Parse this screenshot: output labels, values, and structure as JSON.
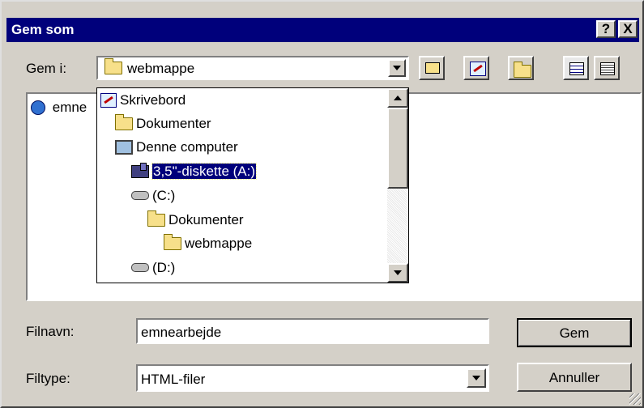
{
  "window": {
    "title": "Gem som",
    "help_label": "?",
    "close_label": "X"
  },
  "location": {
    "label": "Gem i:",
    "current": "webmappe"
  },
  "file_list": {
    "items": [
      {
        "name": "emne",
        "icon": "ie-icon"
      }
    ]
  },
  "dropdown_tree": {
    "items": [
      {
        "label": "Skrivebord",
        "icon": "desktop-icon",
        "indent": 0,
        "selected": false
      },
      {
        "label": "Dokumenter",
        "icon": "folder-icon",
        "indent": 1,
        "selected": false
      },
      {
        "label": "Denne computer",
        "icon": "computer-icon",
        "indent": 1,
        "selected": false
      },
      {
        "label": "3,5\"-diskette (A:)",
        "icon": "floppy-icon",
        "indent": 2,
        "selected": true
      },
      {
        "label": "(C:)",
        "icon": "drive-icon",
        "indent": 2,
        "selected": false
      },
      {
        "label": "Dokumenter",
        "icon": "folder-icon",
        "indent": 3,
        "selected": false
      },
      {
        "label": "webmappe",
        "icon": "folder-icon",
        "indent": 4,
        "selected": false
      },
      {
        "label": "(D:)",
        "icon": "drive-icon",
        "indent": 2,
        "selected": false
      }
    ]
  },
  "filename": {
    "label": "Filnavn:",
    "value": "emnearbejde"
  },
  "filetype": {
    "label": "Filtype:",
    "value": "HTML-filer"
  },
  "buttons": {
    "save": "Gem",
    "cancel": "Annuller"
  },
  "toolbar": {
    "icons": [
      "up-one-level-icon",
      "desktop-icon",
      "new-folder-icon",
      "list-view-icon",
      "details-view-icon"
    ]
  },
  "colors": {
    "titlebar": "#00007b",
    "face": "#d4d0c8",
    "selection": "#00007b"
  }
}
